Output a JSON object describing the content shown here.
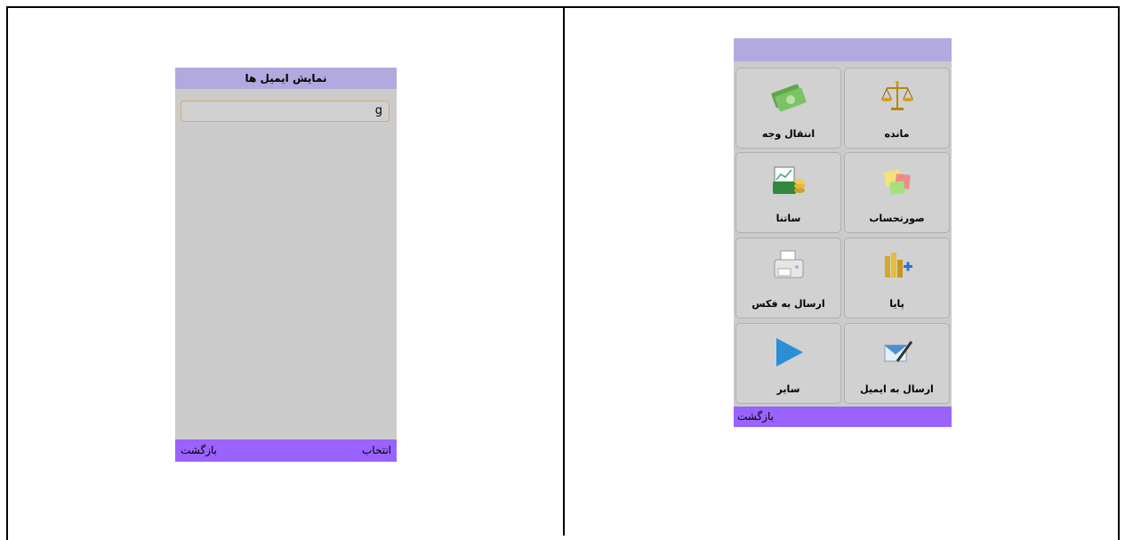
{
  "left_screen": {
    "title": "نمایش ایمیل ها",
    "input_value": "g",
    "softkey_left": "بازگشت",
    "softkey_right": "انتخاب"
  },
  "right_screen": {
    "tiles": [
      {
        "label": "مانده",
        "icon": "scales-icon"
      },
      {
        "label": "انتقال وجه",
        "icon": "money-icon"
      },
      {
        "label": "صورتحساب",
        "icon": "statement-notes-icon"
      },
      {
        "label": "ساتنا",
        "icon": "chart-coins-icon"
      },
      {
        "label": "پایا",
        "icon": "coins-plus-icon"
      },
      {
        "label": "ارسال به فکس",
        "icon": "fax-icon"
      },
      {
        "label": "ارسال به ایمیل",
        "icon": "email-pen-icon"
      },
      {
        "label": "سایر",
        "icon": "play-arrow-icon"
      }
    ],
    "softkey_left": "بازگشت"
  },
  "colors": {
    "title_bar": "#b3a9de",
    "softkey_bar": "#9a63ff",
    "screen_bg": "#cbcbcb"
  }
}
